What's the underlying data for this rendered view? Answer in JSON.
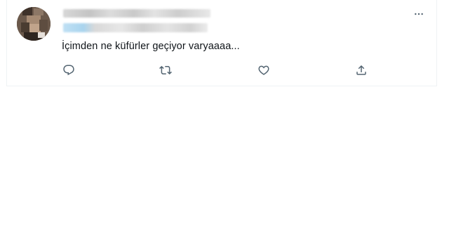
{
  "tweet": {
    "text": "İçimden ne küfürler geçiyor varyaaaa..."
  },
  "icons": {
    "more": "more-horizontal-icon",
    "reply": "reply-icon",
    "retweet": "retweet-icon",
    "like": "heart-icon",
    "share": "share-icon"
  },
  "colors": {
    "text": "#0f1419",
    "icon": "#536471",
    "border": "#eff3f4"
  }
}
